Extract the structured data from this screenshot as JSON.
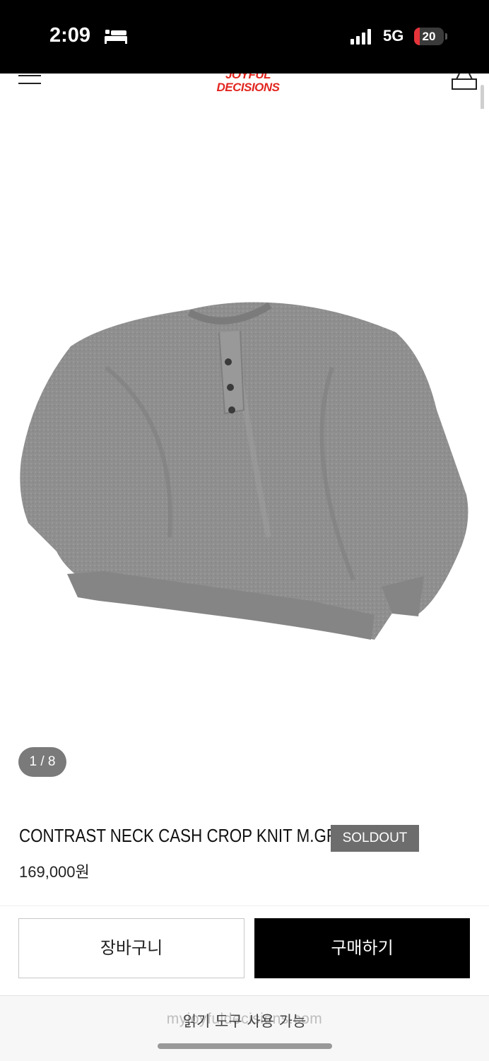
{
  "status_bar": {
    "time": "2:09",
    "network": "5G",
    "battery_level": "20",
    "battery_fraction": 0.2
  },
  "header": {
    "logo_line1": "JOYFUL",
    "logo_line2": "DECISIONS",
    "brand_color": "#e22620"
  },
  "gallery": {
    "counter": "1 / 8"
  },
  "product": {
    "title": "CONTRAST NECK CASH CROP KNIT M.GREY",
    "badge": "SOLDOUT",
    "price": "169,000원"
  },
  "actions": {
    "cart_label": "장바구니",
    "buy_label": "구매하기"
  },
  "browser": {
    "url": "myjoyfuldecisions.com",
    "reader_label": "읽기 도구 사용 가능"
  },
  "icons": [
    "bed-icon",
    "signal-icon",
    "battery-icon",
    "menu-icon",
    "bag-icon"
  ]
}
